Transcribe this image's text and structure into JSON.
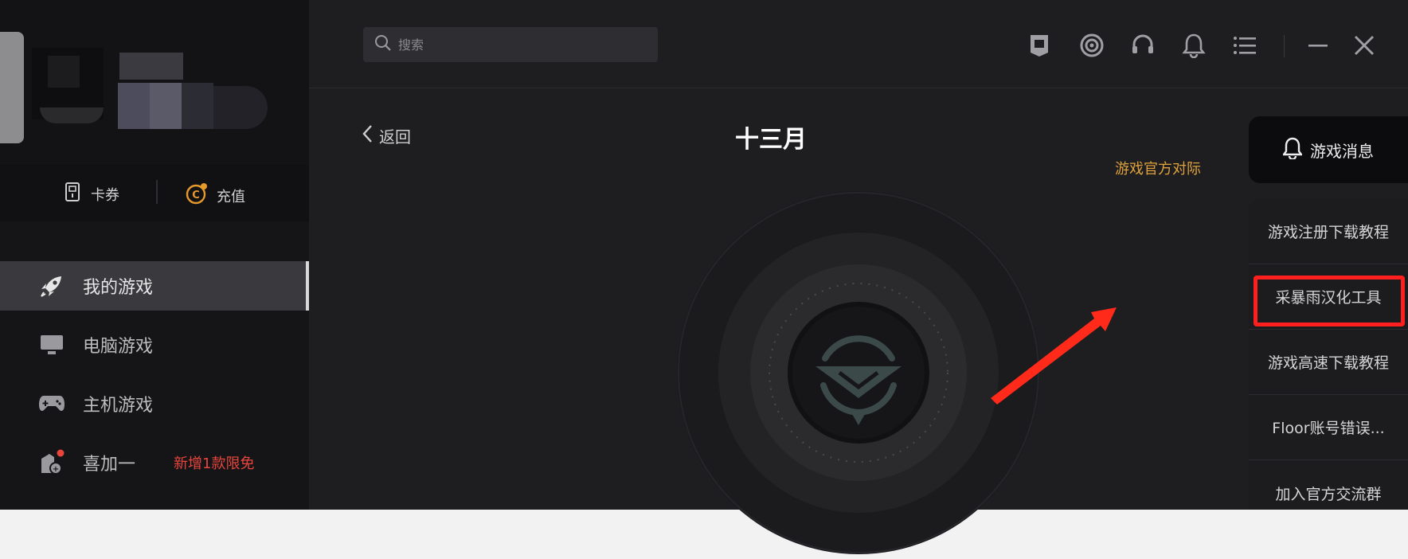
{
  "sidebar": {
    "wallet": {
      "card_label": "卡券",
      "recharge_label": "充值"
    },
    "nav": [
      {
        "label": "我的游戏",
        "icon": "rocket-icon",
        "active": true
      },
      {
        "label": "电脑游戏",
        "icon": "monitor-icon"
      },
      {
        "label": "主机游戏",
        "icon": "gamepad-icon"
      },
      {
        "label": "喜加一",
        "icon": "gift-icon",
        "promo": "新增1款限免"
      }
    ]
  },
  "topbar": {
    "search": {
      "placeholder": "搜索"
    },
    "icons": [
      "badge-icon",
      "target-icon",
      "headset-icon",
      "bell-icon",
      "menu-icon",
      "minimize-icon",
      "close-icon"
    ]
  },
  "content": {
    "back_label": "返回",
    "title": "十三月",
    "announcement": "游戏官方对际"
  },
  "right_panel": {
    "header": "游戏消息",
    "items": [
      "游戏注册下载教程",
      "采暴雨汉化工具",
      "游戏高速下载教程",
      "Floor账号错误...",
      "加入官方交流群"
    ]
  },
  "colors": {
    "sidebar_bg": "#151518",
    "main_bg": "#1e1e21",
    "accent_orange": "#e0a23c",
    "promo_red": "#e8453c",
    "highlight_red": "#ff1f1f"
  }
}
